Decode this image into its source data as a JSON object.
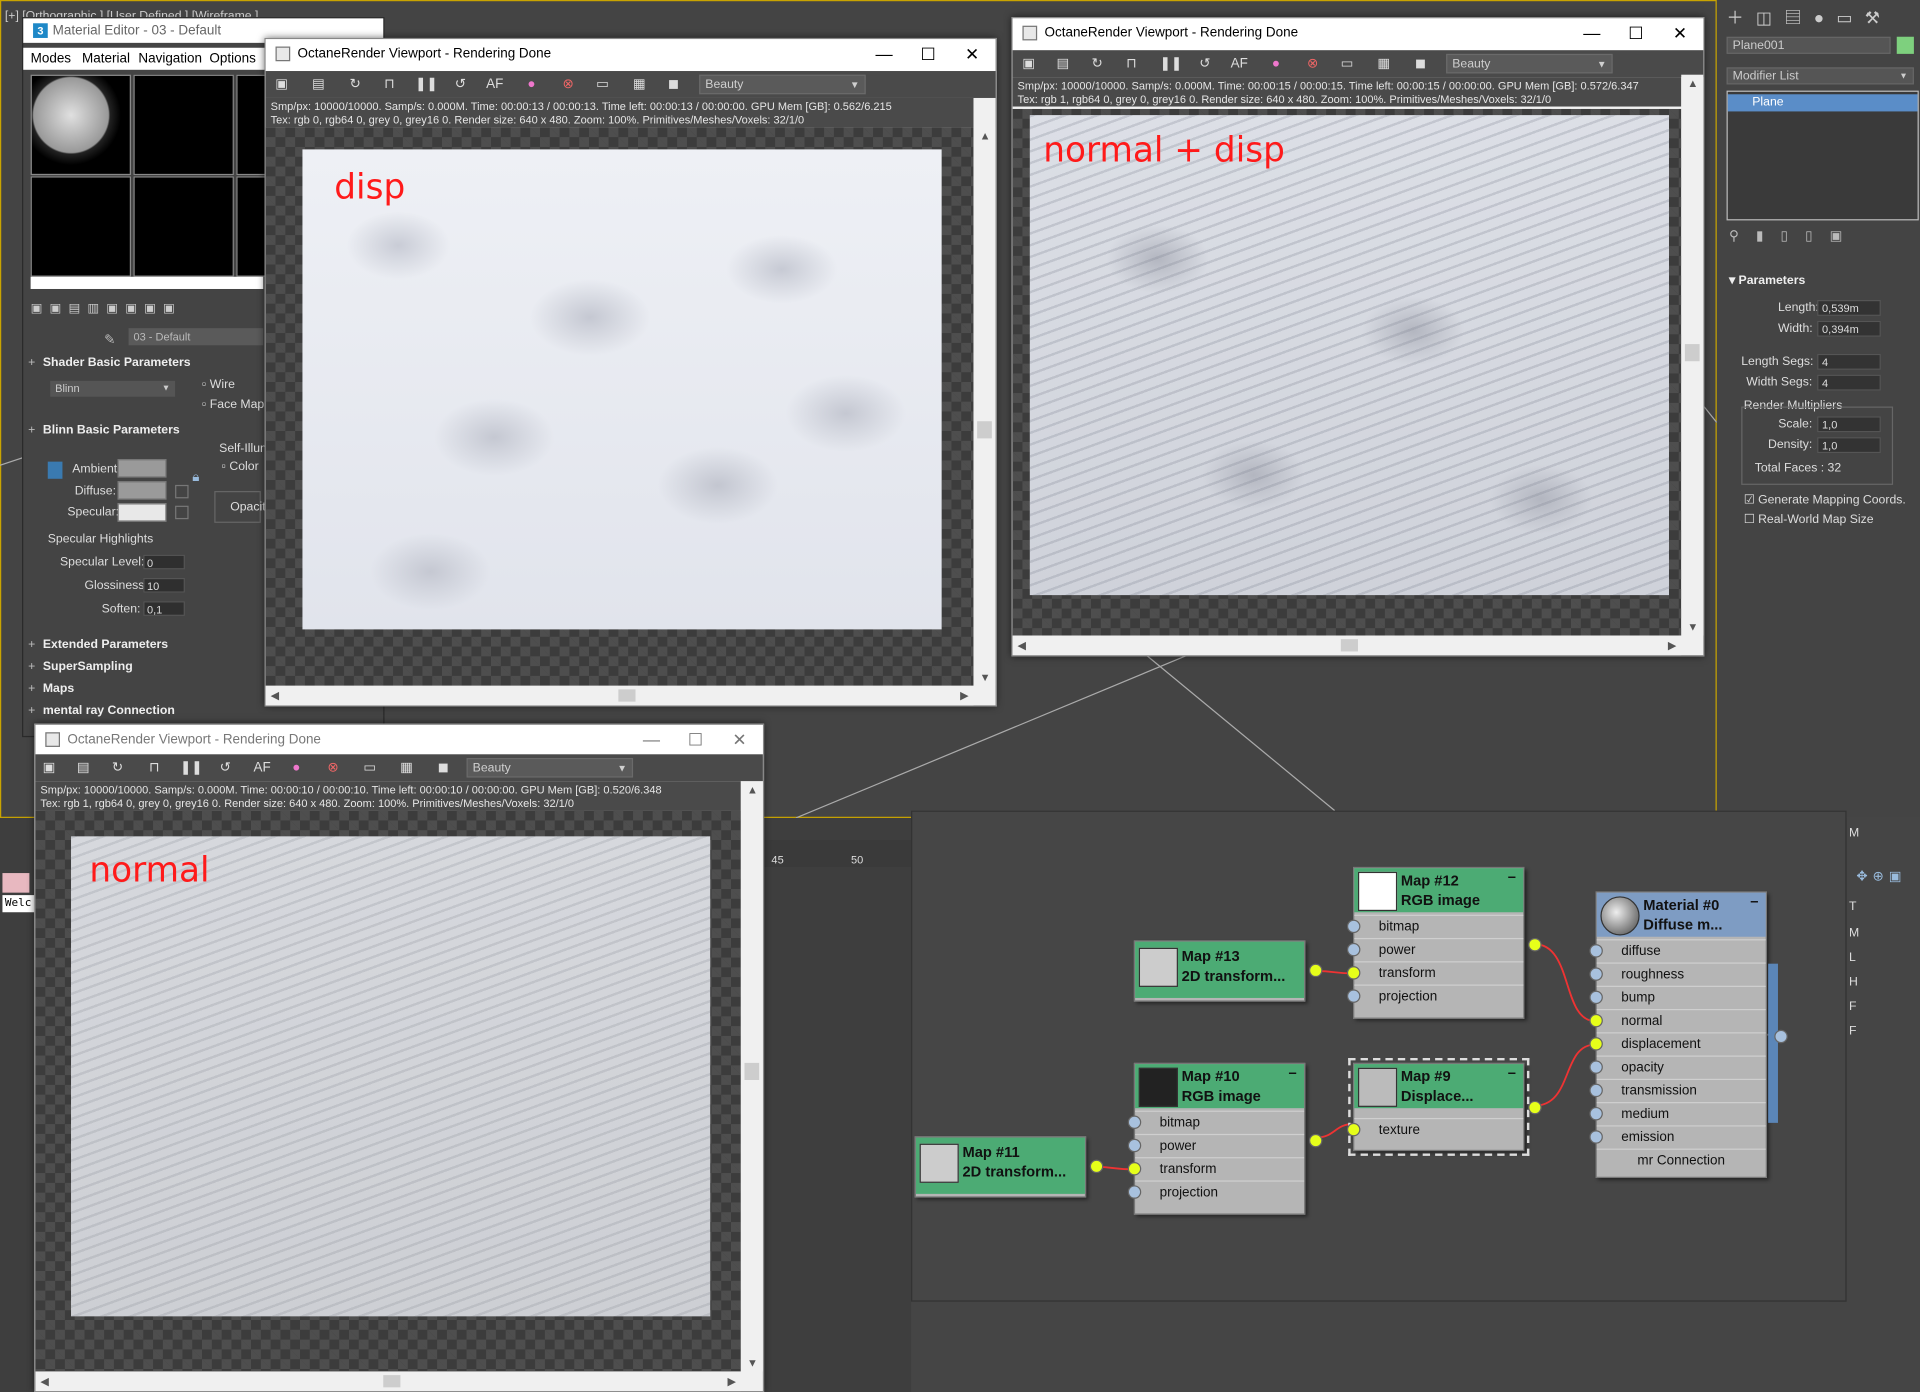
{
  "viewport_label": "[+] [Orthographic ] [User Defined ] [Wireframe ]",
  "material_editor": {
    "title": "Material Editor - 03 - Default",
    "menu": [
      "Modes",
      "Material",
      "Navigation",
      "Options"
    ],
    "material_name": "03 - Default",
    "shader_rollout": "Shader Basic Parameters",
    "shader_type": "Blinn",
    "wire_label": "Wire",
    "face_map_label": "Face Map",
    "blinn_rollout": "Blinn Basic Parameters",
    "self_illum_label": "Self-Illum",
    "color_label": "Color",
    "opacity_label": "Opacit",
    "ambient_label": "Ambient:",
    "diffuse_label": "Diffuse:",
    "specular_label": "Specular:",
    "specular_highlights": "Specular Highlights",
    "specular_level_label": "Specular Level:",
    "specular_level_value": "0",
    "glossiness_label": "Glossiness:",
    "glossiness_value": "10",
    "soften_label": "Soften:",
    "soften_value": "0,1",
    "rollouts": [
      "Extended Parameters",
      "SuperSampling",
      "Maps",
      "mental ray Connection"
    ]
  },
  "render_windows": {
    "disp": {
      "title": "OctaneRender Viewport - Rendering Done",
      "pass": "Beauty",
      "info_line1": "Smp/px: 10000/10000.   Samp/s: 0.000M.   Time: 00:00:13 / 00:00:13.   Time left: 00:00:13 / 00:00:00.   GPU Mem [GB]: 0.562/6.215",
      "info_line2": "Tex: rgb 0, rgb64 0, grey 0, grey16 0.   Render size: 640 x 480.   Zoom: 100%.   Primitives/Meshes/Voxels: 32/1/0",
      "overlay": "disp"
    },
    "normal_disp": {
      "title": "OctaneRender Viewport - Rendering Done",
      "pass": "Beauty",
      "info_line1": "Smp/px: 10000/10000.   Samp/s: 0.000M.   Time: 00:00:15 / 00:00:15.   Time left: 00:00:15 / 00:00:00.   GPU Mem [GB]: 0.572/6.347",
      "info_line2": "Tex: rgb 1, rgb64 0, grey 0, grey16 0.   Render size: 640 x 480.   Zoom: 100%.   Primitives/Meshes/Voxels: 32/1/0",
      "overlay": "normal + disp"
    },
    "normal": {
      "title": "OctaneRender Viewport - Rendering Done",
      "pass": "Beauty",
      "info_line1": "Smp/px: 10000/10000.   Samp/s: 0.000M.   Time: 00:00:10 / 00:00:10.   Time left: 00:00:10 / 00:00:00.   GPU Mem [GB]: 0.520/6.348",
      "info_line2": "Tex: rgb 1, rgb64 0, grey 0, grey16 0.   Render size: 640 x 480.   Zoom: 100%.   Primitives/Meshes/Voxels: 32/1/0",
      "overlay": "normal"
    }
  },
  "command_panel": {
    "object_name": "Plane001",
    "modifier_list": "Modifier List",
    "stack_item": "Plane",
    "parameters": "Parameters",
    "length_label": "Length:",
    "length_value": "0,539m",
    "width_label": "Width:",
    "width_value": "0,394m",
    "length_segs_label": "Length Segs:",
    "length_segs_value": "4",
    "width_segs_label": "Width Segs:",
    "width_segs_value": "4",
    "render_multipliers": "Render Multipliers",
    "scale_label": "Scale:",
    "scale_value": "1,0",
    "density_label": "Density:",
    "density_value": "1,0",
    "total_faces": "Total Faces : 32",
    "gen_mapping": "Generate Mapping Coords.",
    "real_world": "Real-World Map Size"
  },
  "timeline": {
    "tick_a": "45",
    "tick_b": "50"
  },
  "welcome_text": "Welc",
  "right_strip": [
    "M",
    "T",
    "M",
    "L",
    "H",
    "F",
    "F"
  ],
  "nodes": {
    "map12": {
      "line1": "Map #12",
      "line2": "RGB image",
      "ports": [
        "bitmap",
        "power",
        "transform",
        "projection"
      ]
    },
    "map13": {
      "line1": "Map #13",
      "line2": "2D transform..."
    },
    "map10": {
      "line1": "Map #10",
      "line2": "RGB image",
      "ports": [
        "bitmap",
        "power",
        "transform",
        "projection"
      ]
    },
    "map11": {
      "line1": "Map #11",
      "line2": "2D transform..."
    },
    "map9": {
      "line1": "Map #9",
      "line2": "Displace...",
      "ports": [
        "texture"
      ]
    },
    "material0": {
      "line1": "Material #0",
      "line2": "Diffuse m...",
      "ports": [
        "diffuse",
        "roughness",
        "bump",
        "normal",
        "displacement",
        "opacity",
        "transmission",
        "medium",
        "emission"
      ],
      "footer": "mr Connection"
    }
  }
}
